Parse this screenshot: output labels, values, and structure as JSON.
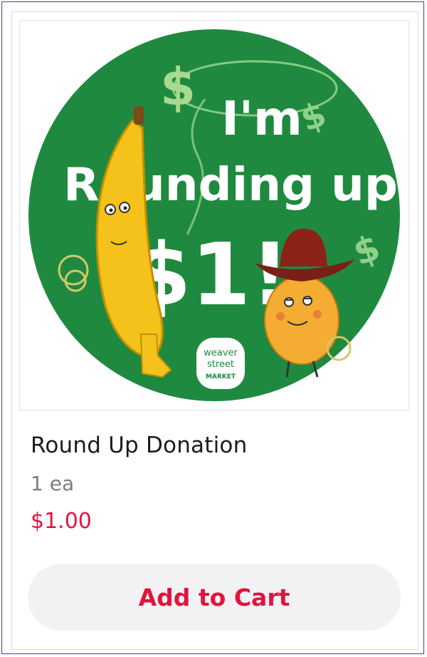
{
  "product": {
    "image": {
      "headline_line1": "I'm",
      "headline_line2": "Rounding up",
      "headline_line3": "$1!",
      "logo_line1": "weaver",
      "logo_line2": "street",
      "logo_line3": "MARKET",
      "circle_color": "#1f8a3f",
      "dollar_sign_color": "#8fd18a"
    },
    "title": "Round Up Donation",
    "size": "1 ea",
    "price": "$1.00",
    "add_to_cart_label": "Add to Cart"
  },
  "colors": {
    "accent": "#e1153e",
    "button_bg": "#f2f2f4",
    "frame_border": "#4b3d8f"
  }
}
